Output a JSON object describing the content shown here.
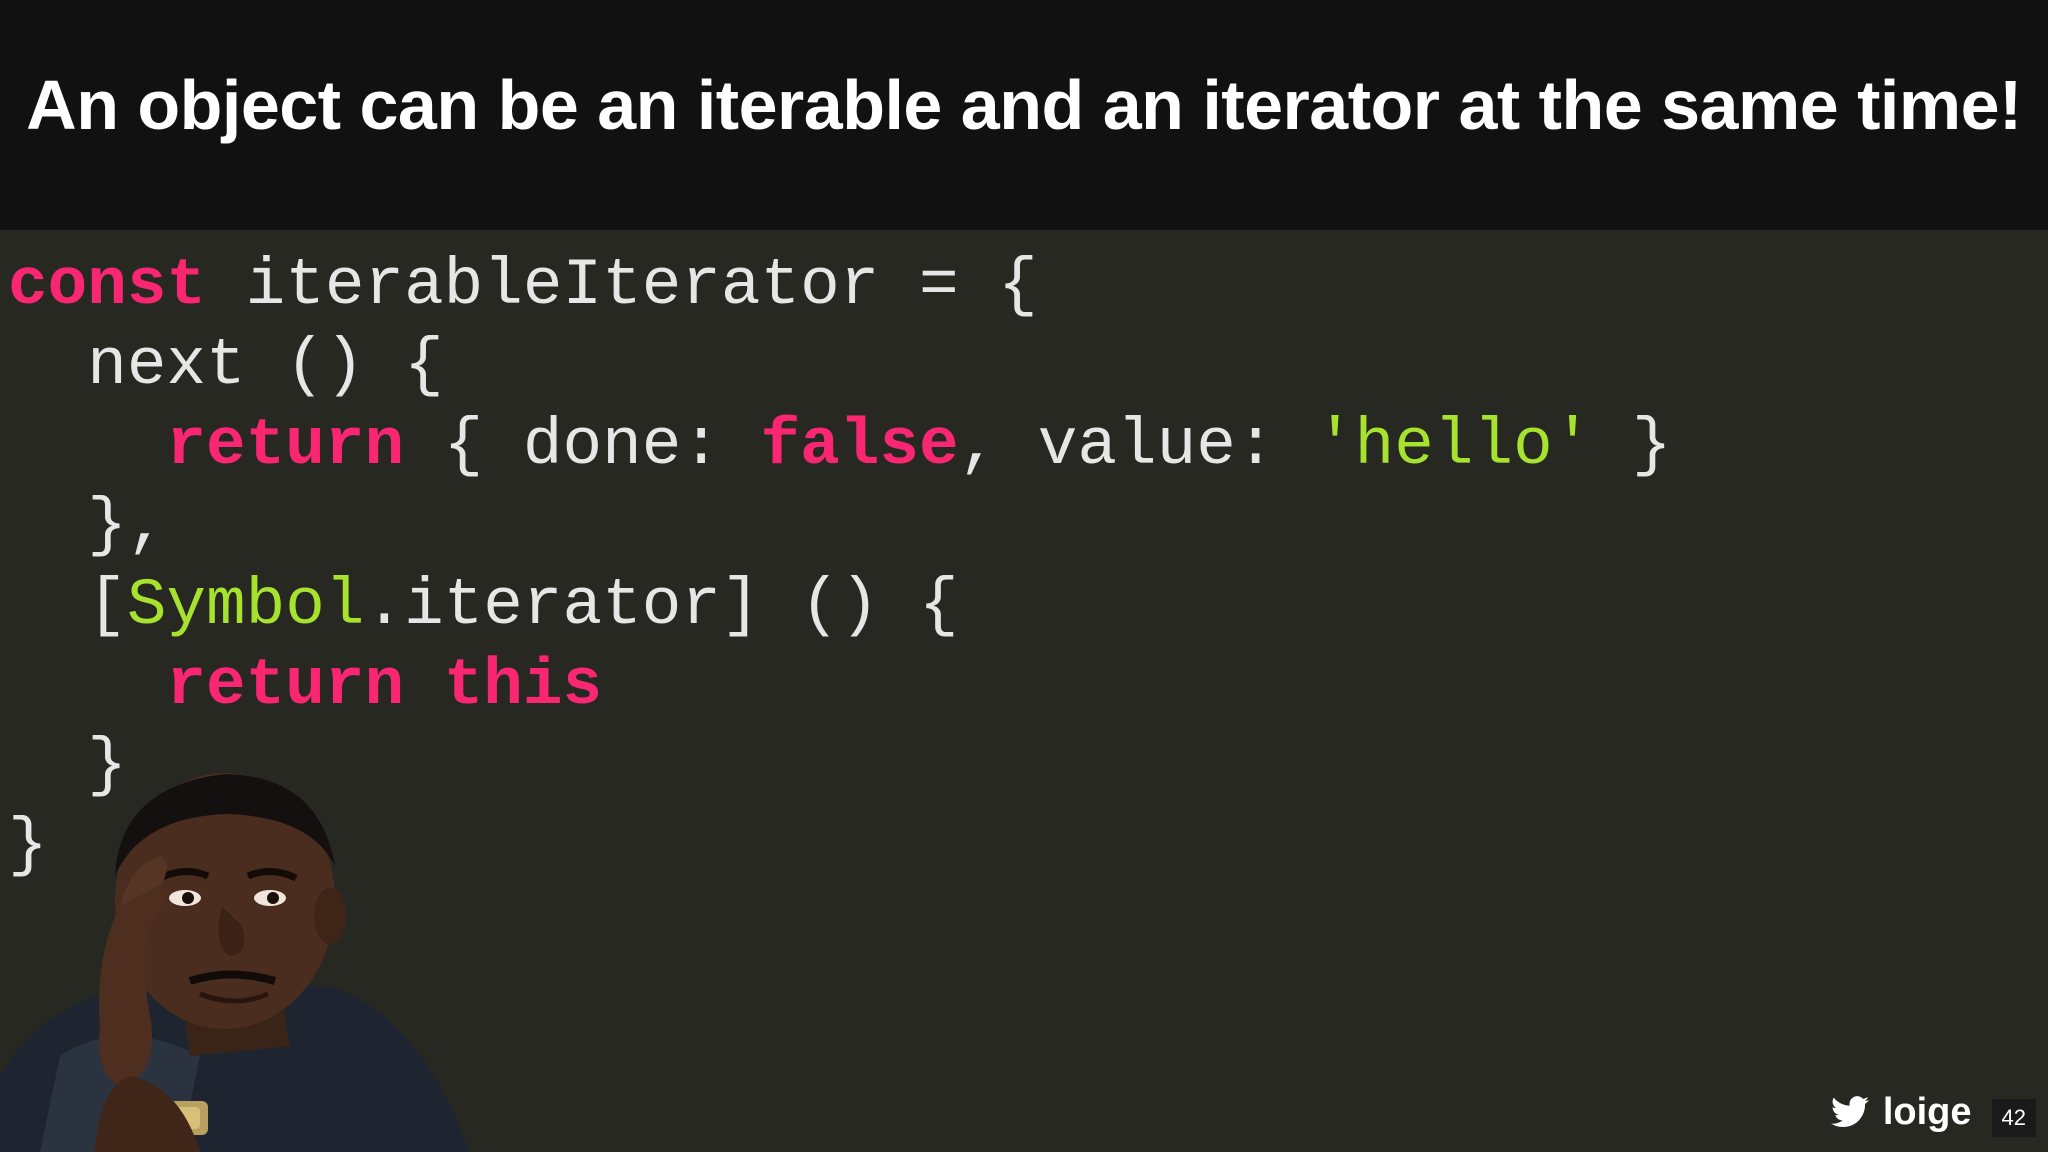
{
  "title": {
    "part1": "An object can be an ",
    "bold1": "iterable",
    "part2": " and an ",
    "bold2": "iterator",
    "part3": " at the same time!"
  },
  "code": {
    "line1": {
      "kw": "const",
      "rest": " iterableIterator = {"
    },
    "line2": {
      "text": "  next () {"
    },
    "line3": {
      "indent": "    ",
      "kw_return": "return",
      "mid1": " { done: ",
      "kw_false": "false",
      "mid2": ", value: ",
      "str": "'hello'",
      "end": " }"
    },
    "line4": {
      "text": "  },"
    },
    "line5": {
      "pre": "  [",
      "ty": "Symbol",
      "rest": ".iterator] () {"
    },
    "line6": {
      "indent": "    ",
      "kw_return": "return",
      "sp": " ",
      "kw_this": "this"
    },
    "line7": {
      "text": "  }"
    },
    "line8": {
      "text": "}"
    }
  },
  "footer": {
    "twitter_handle": "loige",
    "page_number": "42"
  },
  "colors": {
    "keyword": "#f92672",
    "string": "#a6e22e",
    "code_bg": "#272822",
    "header_bg": "#111111"
  },
  "icons": {
    "twitter": "twitter-bird-icon"
  }
}
